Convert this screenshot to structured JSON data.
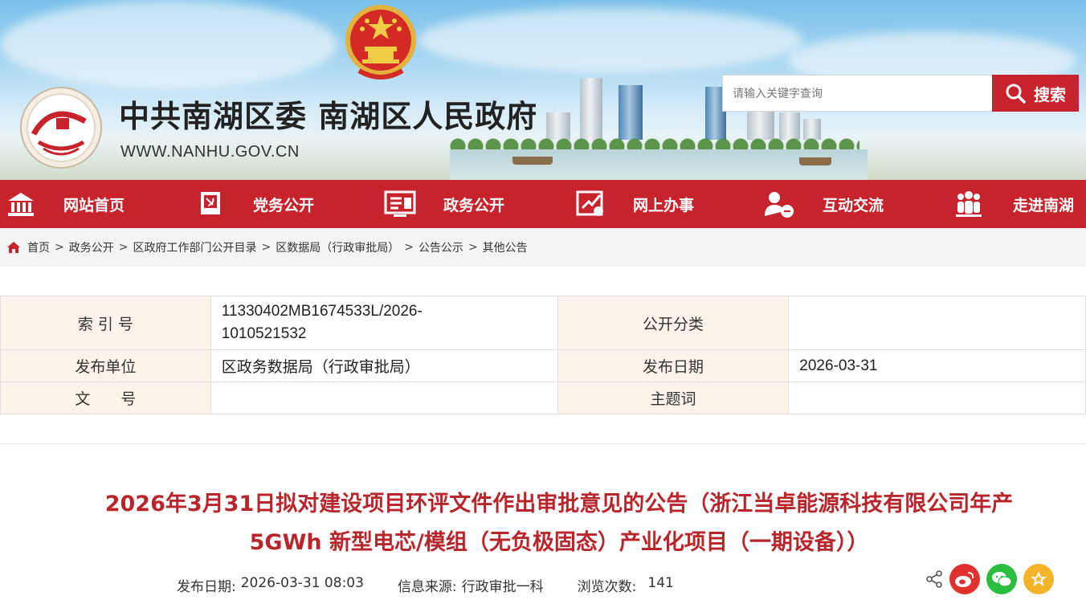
{
  "header": {
    "site_title": "中共南湖区委 南湖区人民政府",
    "site_url": "WWW.NANHU.GOV.CN",
    "search": {
      "placeholder": "请输入关键字查询",
      "button_label": "搜索"
    }
  },
  "nav": {
    "items": [
      {
        "label": "网站首页",
        "icon": "home-icon"
      },
      {
        "label": "党务公开",
        "icon": "party-flag-icon"
      },
      {
        "label": "政务公开",
        "icon": "document-list-icon"
      },
      {
        "label": "网上办事",
        "icon": "online-service-icon"
      },
      {
        "label": "互动交流",
        "icon": "user-chat-icon"
      },
      {
        "label": "走进南湖",
        "icon": "people-group-icon"
      }
    ]
  },
  "breadcrumb": {
    "icon": "home-icon",
    "items": [
      "首页",
      "政务公开",
      "区政府工作部门公开目录",
      "区数据局（行政审批局）",
      "公告公示",
      "其他公告"
    ]
  },
  "meta": {
    "index_label": "索 引 号",
    "index_value_line1": "11330402MB1674533L/2026-",
    "index_value_line2": "1010521532",
    "category_label": "公开分类",
    "category_value": "",
    "publisher_label": "发布单位",
    "publisher_value": "区政务数据局（行政审批局）",
    "date_label": "发布日期",
    "date_value": "2026-03-31",
    "docno_label": "文　　号",
    "docno_value": "",
    "keywords_label": "主题词",
    "keywords_value": ""
  },
  "article": {
    "title_line1": "2026年3月31日拟对建设项目环评文件作出审批意见的公告（浙江当卓能源科技有限公司年产",
    "title_line2": "5GWh 新型电芯/模组（无负极固态）产业化项目（一期设备））",
    "publish_label": "发布日期:",
    "publish_value": "2026-03-31 08:03",
    "source_label": "信息来源:",
    "source_value": "行政审批一科",
    "views_label": "浏览次数:",
    "views_value": "141"
  },
  "share": {
    "icons": [
      "share-icon",
      "weibo-icon",
      "wechat-icon",
      "favorite-star-icon"
    ]
  },
  "colors": {
    "brand_red": "#c7232c",
    "title_red": "#b8262c",
    "table_key_bg": "#fcf4ea",
    "weibo": "#e2302e",
    "wechat": "#2bbd3d",
    "star": "#f4b42a"
  }
}
